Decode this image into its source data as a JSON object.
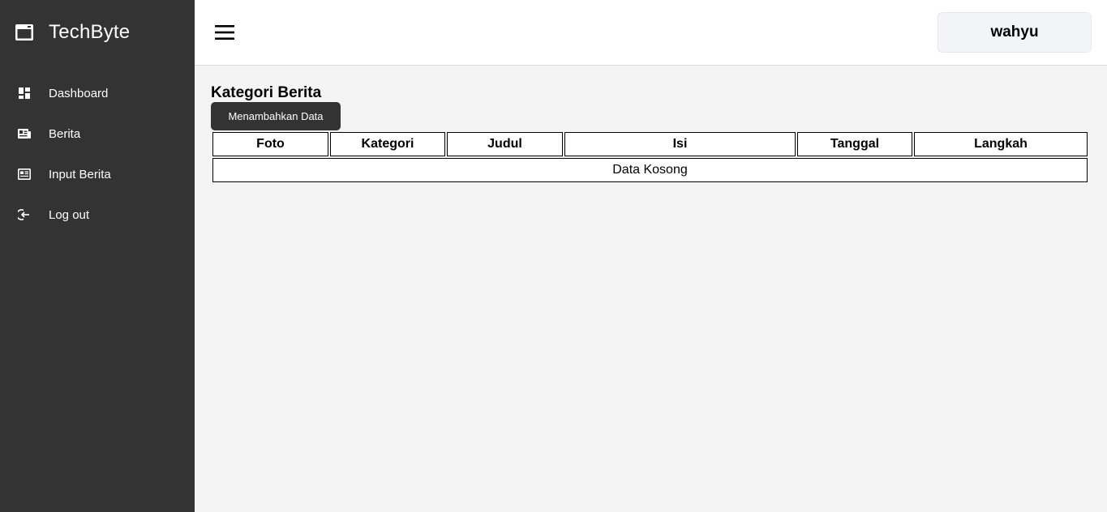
{
  "brand": {
    "name": "TechByte",
    "logo_icon": "browser-window-icon"
  },
  "sidebar": {
    "items": [
      {
        "label": "Dashboard",
        "icon": "dashboard-grid-icon"
      },
      {
        "label": "Berita",
        "icon": "newspaper-icon"
      },
      {
        "label": "Input Berita",
        "icon": "article-input-icon"
      },
      {
        "label": "Log out",
        "icon": "logout-icon"
      }
    ]
  },
  "header": {
    "menu_icon": "hamburger-menu-icon",
    "user_name": "wahyu"
  },
  "main": {
    "title": "Kategori Berita",
    "add_button_label": "Menambahkan Data",
    "table": {
      "columns": [
        "Foto",
        "Kategori",
        "Judul",
        "Isi",
        "Tanggal",
        "Langkah"
      ],
      "empty_message": "Data Kosong"
    }
  },
  "colors": {
    "sidebar_bg": "#333333",
    "page_bg": "#f4f4f4",
    "button_bg": "#333333",
    "user_button_bg": "#f3f4f7"
  }
}
